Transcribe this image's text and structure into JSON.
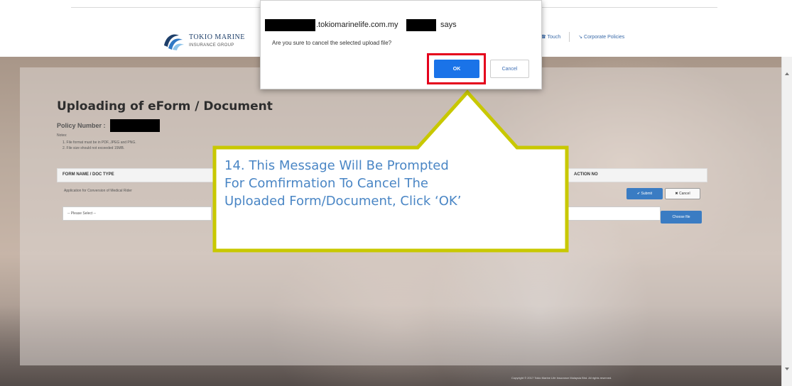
{
  "header": {
    "logo_line1": "TOKIO MARINE",
    "logo_line2": "INSURANCE GROUP",
    "nav_links": [
      "☎ Touch",
      "↘ Corporate Policies"
    ]
  },
  "page": {
    "title": "Uploading of eForm / Document",
    "policy_label": "Policy Number :",
    "notes_label": "Notes:",
    "notes": [
      "1. File format must be in PDF, JPEG and PNG.",
      "2. File size should not exceeded 15MB."
    ],
    "table": {
      "col_form": "FORM NAME / DOC TYPE",
      "col_action": "ACTION NO",
      "row1_form": "Application for Conversion of Medical Rider",
      "submit_label": "✔ Submit",
      "cancel_label": "✖ Cancel",
      "select_placeholder": "-- Please Select --",
      "choose_file_label": "Choose file"
    },
    "footer": "Copyright © 2017 Tokio Marine Life Insurance Malaysia Bhd. All rights reserved."
  },
  "dialog": {
    "domain": ".tokiomarinelife.com.my",
    "says": "says",
    "message": "Are you sure to cancel the selected upload file?",
    "ok_label": "OK",
    "cancel_label": "Cancel"
  },
  "callout": {
    "lines": [
      "14. This Message Will Be Prompted",
      "For Comfirmation To Cancel The",
      "Uploaded Form/Document, Click ‘OK’"
    ]
  },
  "colors": {
    "callout_border": "#c8c800",
    "highlight": "#e4001c",
    "primary_button": "#1a73e8"
  }
}
